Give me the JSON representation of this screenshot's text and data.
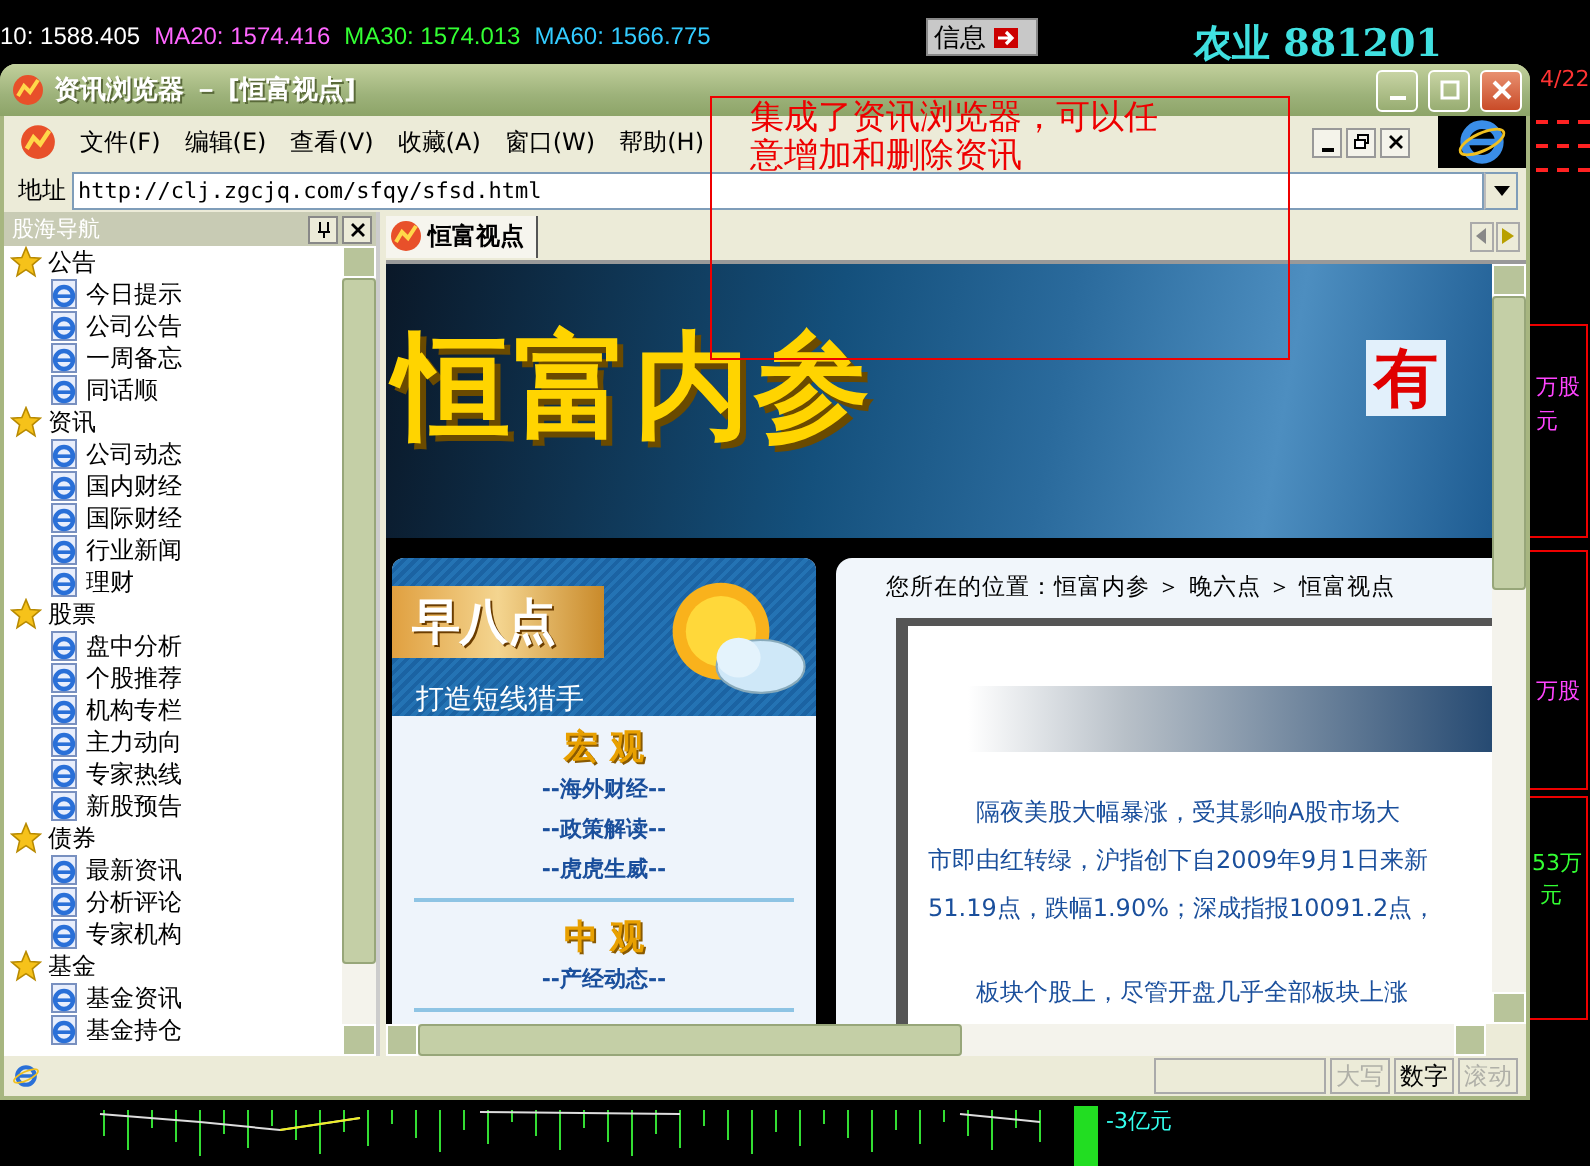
{
  "ticker": [
    {
      "label": "10: 1588.405",
      "color": "#ffffff"
    },
    {
      "label": "MA20: 1574.416",
      "color": "#ff66ff"
    },
    {
      "label": "MA30: 1574.013",
      "color": "#33ff33"
    },
    {
      "label": "MA60: 1566.775",
      "color": "#33ccff"
    }
  ],
  "info_button": {
    "label": "信息"
  },
  "stock_title": "农业 881201",
  "side_labels": [
    {
      "text": "4/22",
      "color": "#ff3333"
    },
    {
      "text": "万股",
      "color": "#ff44ff"
    },
    {
      "text": "元",
      "color": "#ff44ff"
    },
    {
      "text": "万股",
      "color": "#ff44ff"
    },
    {
      "text": "53万",
      "color": "#33ff33"
    },
    {
      "text": "元",
      "color": "#33ff33"
    }
  ],
  "bottom_label": "-3亿元",
  "window": {
    "title": "资讯浏览器 － [恒富视点]"
  },
  "menu": [
    "文件(F)",
    "编辑(E)",
    "查看(V)",
    "收藏(A)",
    "窗口(W)",
    "帮助(H)"
  ],
  "address": {
    "label": "地址",
    "value": "http://clj.zgcjq.com/sfqy/sfsd.html"
  },
  "annotation": "集成了资讯浏览器，可以任意增加和删除资讯",
  "sidebar": {
    "title": "股海导航",
    "items": [
      {
        "label": "公告",
        "children": [
          {
            "label": "今日提示"
          },
          {
            "label": "公司公告"
          },
          {
            "label": "一周备忘"
          },
          {
            "label": "同话顺"
          }
        ]
      },
      {
        "label": "资讯",
        "children": [
          {
            "label": "公司动态"
          },
          {
            "label": "国内财经"
          },
          {
            "label": "国际财经"
          },
          {
            "label": "行业新闻"
          },
          {
            "label": "理财"
          }
        ]
      },
      {
        "label": "股票",
        "children": [
          {
            "label": "盘中分析"
          },
          {
            "label": "个股推荐"
          },
          {
            "label": "机构专栏"
          },
          {
            "label": "主力动向"
          },
          {
            "label": "专家热线"
          },
          {
            "label": "新股预告"
          }
        ]
      },
      {
        "label": "债券",
        "children": [
          {
            "label": "最新资讯"
          },
          {
            "label": "分析评论"
          },
          {
            "label": "专家机构"
          }
        ]
      },
      {
        "label": "基金",
        "children": [
          {
            "label": "基金资讯"
          },
          {
            "label": "基金持仓"
          }
        ]
      }
    ]
  },
  "tabs": [
    {
      "label": "恒富视点",
      "selected": true
    }
  ],
  "page": {
    "banner_title": "恒富内参",
    "banner_script": "有",
    "card": {
      "title": "早八点",
      "subtitle": "打造短线猎手",
      "sections": [
        {
          "heading": "宏 观",
          "links": [
            "--海外财经--",
            "--政策解读--",
            "--虎虎生威--"
          ]
        },
        {
          "heading": "中 观",
          "links": [
            "--产经动态--"
          ]
        }
      ]
    },
    "breadcrumb": "您所在的位置：恒富内参 ＞ 晚六点 ＞ 恒富视点",
    "paragraphs": [
      [
        "隔夜美股大幅暴涨，受其影响A股市场大",
        "市即由红转绿，沪指创下自2009年9月1日来新",
        "51.19点，跌幅1.90%；深成指报10091.2点，"
      ],
      [
        "板块个股上，尽管开盘几乎全部板块上涨"
      ]
    ]
  },
  "status_bar": {
    "keys": [
      {
        "label": "大写",
        "on": false
      },
      {
        "label": "数字",
        "on": true
      },
      {
        "label": "滚动",
        "on": false
      }
    ]
  }
}
